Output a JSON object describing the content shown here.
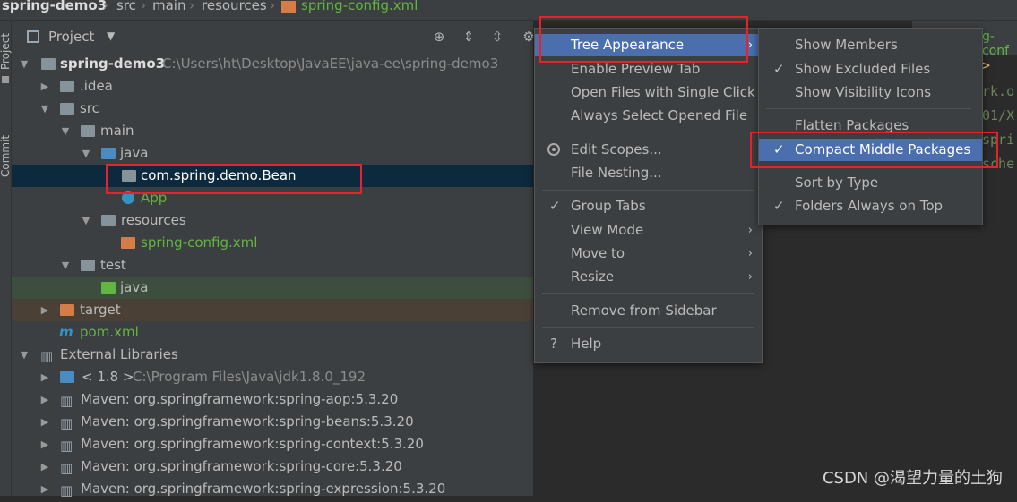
{
  "breadcrumb": {
    "project": "spring-demo3",
    "items": [
      "src",
      "main",
      "resources"
    ],
    "file": "spring-config.xml"
  },
  "stripe": {
    "project_tab": "Project",
    "commit_tab": "Commit"
  },
  "panel": {
    "title": "Project"
  },
  "tree": {
    "root_name": "spring-demo3",
    "root_path": "C:\\Users\\ht\\Desktop\\JavaEE\\java-ee\\spring-demo3",
    "idea": ".idea",
    "src": "src",
    "main": "main",
    "java": "java",
    "package": "com.spring.demo.Bean",
    "app": "App",
    "resources": "resources",
    "spring_config": "spring-config.xml",
    "test": "test",
    "test_java": "java",
    "target": "target",
    "pom": "pom.xml",
    "external_libraries": "External Libraries",
    "jdk_label": "< 1.8 >",
    "jdk_path": "C:\\Program Files\\Java\\jdk1.8.0_192",
    "libs": [
      "Maven: org.springframework:spring-aop:5.3.20",
      "Maven: org.springframework:spring-beans:5.3.20",
      "Maven: org.springframework:spring-context:5.3.20",
      "Maven: org.springframework:spring-core:5.3.20",
      "Maven: org.springframework:spring-expression:5.3.20"
    ]
  },
  "editor": {
    "tab_fragment": "g-conf",
    "lines": [
      ">",
      "rk.o",
      "01/X",
      "spri",
      "sche"
    ]
  },
  "menu": {
    "tree_appearance": "Tree Appearance",
    "enable_preview_tab": "Enable Preview Tab",
    "open_single_click": "Open Files with Single Click",
    "always_select": "Always Select Opened File",
    "edit_scopes": "Edit Scopes...",
    "file_nesting": "File Nesting...",
    "group_tabs": "Group Tabs",
    "view_mode": "View Mode",
    "move_to": "Move to",
    "resize": "Resize",
    "remove_sidebar": "Remove from Sidebar",
    "help": "Help"
  },
  "submenu": {
    "show_members": "Show Members",
    "show_excluded": "Show Excluded Files",
    "show_visibility": "Show Visibility Icons",
    "flatten_packages": "Flatten Packages",
    "compact_middle": "Compact Middle Packages",
    "sort_by_type": "Sort by Type",
    "folders_on_top": "Folders Always on Top"
  },
  "watermark": "CSDN @渴望力量的土狗",
  "colors": {
    "accent": "#4b6eaf",
    "highlight_box": "#e8222d",
    "selection": "#0d293e"
  }
}
